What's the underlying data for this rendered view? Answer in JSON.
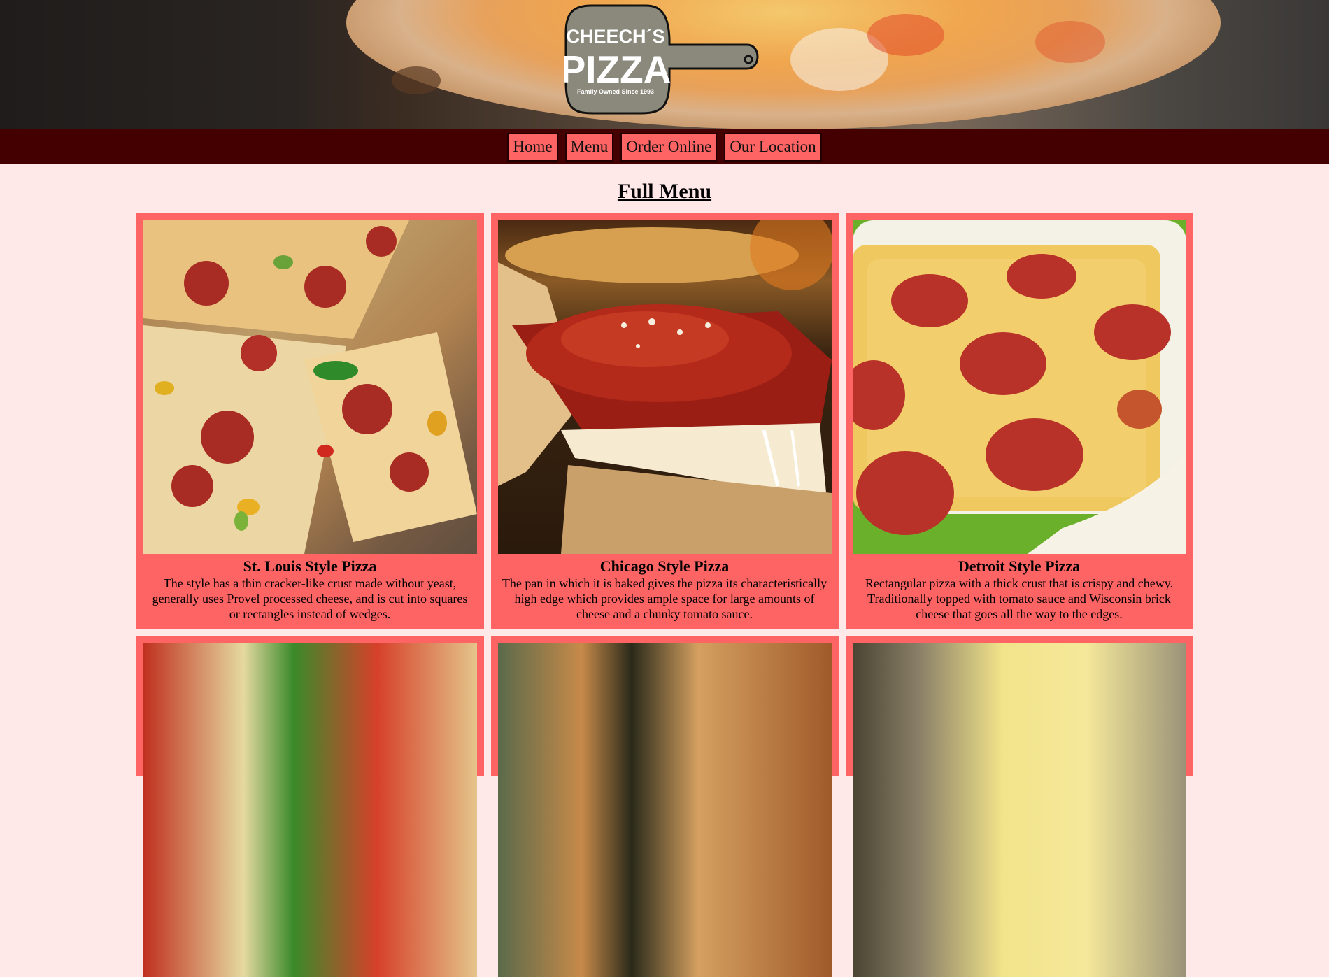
{
  "header": {
    "logo": {
      "line1": "CHEECH´S",
      "line2": "PIZZA",
      "tagline": "Family Owned Since 1993"
    }
  },
  "nav": {
    "items": [
      {
        "label": "Home"
      },
      {
        "label": "Menu"
      },
      {
        "label": "Order Online"
      },
      {
        "label": "Our Location"
      }
    ]
  },
  "page": {
    "title": "Full Menu"
  },
  "menu": {
    "items": [
      {
        "name": "St. Louis Style Pizza",
        "description": "The style has a thin cracker-like crust made without yeast, generally uses Provel processed cheese, and is cut into squares or rectangles instead of wedges."
      },
      {
        "name": "Chicago Style Pizza",
        "description": "The pan in which it is baked gives the pizza its characteristically high edge which provides ample space for large amounts of cheese and a chunky tomato sauce."
      },
      {
        "name": "Detroit Style Pizza",
        "description": "Rectangular pizza with a thick crust that is crispy and chewy. Traditionally topped with tomato sauce and Wisconsin brick cheese that goes all the way to the edges."
      }
    ]
  },
  "colors": {
    "nav_bg": "#440000",
    "card_bg": "#ff6464",
    "page_bg": "#ffe8e8"
  }
}
